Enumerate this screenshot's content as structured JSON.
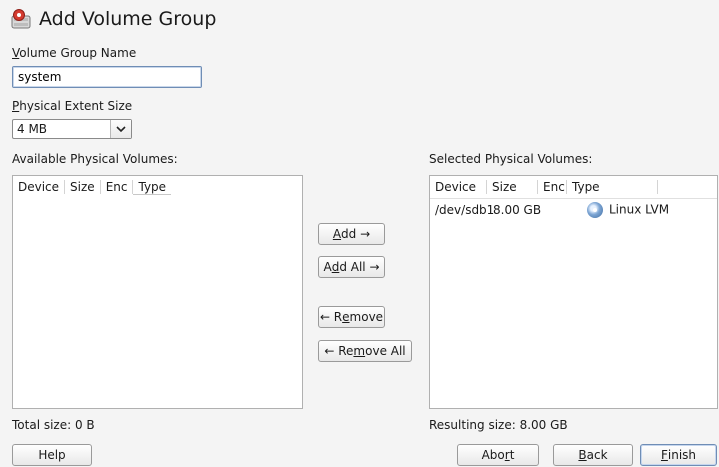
{
  "dialog": {
    "title": "Add Volume Group",
    "icon": "volume-group-icon"
  },
  "vg_name": {
    "label_pre": "",
    "label_key": "V",
    "label_post": "olume Group Name",
    "value": "system"
  },
  "extent": {
    "label_key": "P",
    "label_post": "hysical Extent Size",
    "value": "4 MB"
  },
  "available": {
    "label": "Available Physical Volumes:",
    "columns": [
      "Device",
      "Size",
      "Enc",
      "Type"
    ],
    "rows": [],
    "total": "Total size: 0 B"
  },
  "selected": {
    "label": "Selected Physical Volumes:",
    "columns": [
      "Device",
      "Size",
      "Enc",
      "Type"
    ],
    "rows": [
      {
        "device": "/dev/sdb1",
        "size": "8.00 GB",
        "enc": "",
        "type": "Linux LVM",
        "type_icon": "disk-icon"
      }
    ],
    "total": "Resulting size: 8.00 GB"
  },
  "transfer": {
    "add_pre": "",
    "add_key": "A",
    "add_post": "dd →",
    "addall_pre": "A",
    "addall_key": "d",
    "addall_post": "d All →",
    "remove_pre": "← R",
    "remove_key": "e",
    "remove_post": "move",
    "removeall_pre": "← Re",
    "removeall_key": "m",
    "removeall_post": "ove All"
  },
  "footer": {
    "help": "Help",
    "abort_pre": "Abo",
    "abort_key": "r",
    "abort_post": "t",
    "back_pre": "",
    "back_key": "B",
    "back_post": "ack",
    "finish_pre": "",
    "finish_key": "F",
    "finish_post": "inish"
  }
}
